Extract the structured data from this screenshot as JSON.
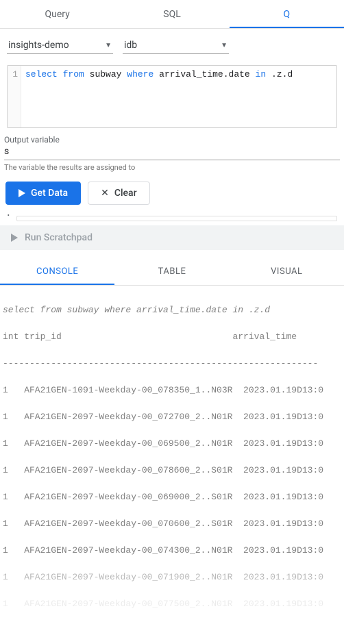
{
  "top_tabs": {
    "query": "Query",
    "sql": "SQL",
    "q": "Q"
  },
  "dropdowns": {
    "source": "insights-demo",
    "db": "idb"
  },
  "editor": {
    "line_no": "1",
    "kw_select": "select",
    "kw_from": "from",
    "tbl": "subway",
    "kw_where": "where",
    "col": "arrival_time.date",
    "kw_in": "in",
    "rhs": ".z.d"
  },
  "outvar": {
    "label": "Output variable",
    "value": "s",
    "help": "The variable the results are assigned to"
  },
  "buttons": {
    "get_data": "Get Data",
    "clear": "Clear",
    "run_scratch": "Run Scratchpad"
  },
  "lower_tabs": {
    "console": "CONSOLE",
    "table": "TABLE",
    "visual": "VISUAL"
  },
  "console": {
    "echo": "select from subway where arrival_time.date in .z.d",
    "header": "int trip_id                                arrival_time",
    "divider": "-----------------------------------------------------------",
    "rows": [
      "1   AFA21GEN-1091-Weekday-00_078350_1..N03R  2023.01.19D13:0",
      "1   AFA21GEN-2097-Weekday-00_072700_2..N01R  2023.01.19D13:0",
      "1   AFA21GEN-2097-Weekday-00_069500_2..N01R  2023.01.19D13:0",
      "1   AFA21GEN-2097-Weekday-00_078600_2..S01R  2023.01.19D13:0",
      "1   AFA21GEN-2097-Weekday-00_069000_2..S01R  2023.01.19D13:0",
      "1   AFA21GEN-2097-Weekday-00_070600_2..S01R  2023.01.19D13:0",
      "1   AFA21GEN-2097-Weekday-00_074300_2..N01R  2023.01.19D13:0",
      "1   AFA21GEN-2097-Weekday-00_071900_2..N01R  2023.01.19D13:0",
      "1   AFA21GEN-2097-Weekday-00_077500_2..N01R  2023.01.19D13:0"
    ]
  }
}
